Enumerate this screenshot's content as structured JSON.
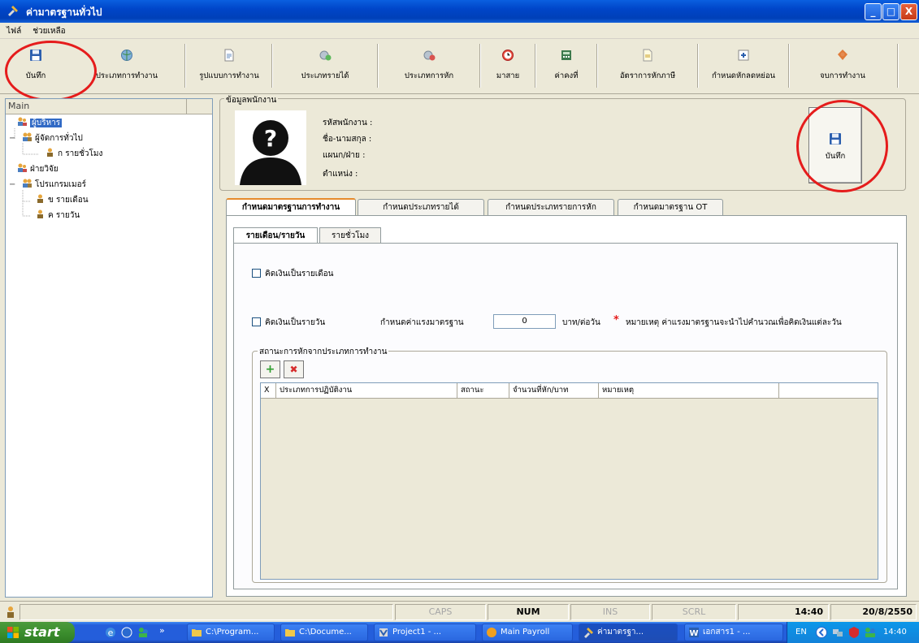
{
  "window": {
    "title": "ค่ามาตรฐานทั่วไป",
    "min": "_",
    "max": "□",
    "close": "X"
  },
  "menu": [
    "ไฟล์",
    "ช่วยเหลือ"
  ],
  "toolbar": [
    {
      "label": "บันทึก",
      "icon": "floppy-disk-icon"
    },
    {
      "label": "ประเภทการทำงาน",
      "icon": "globe-icon"
    },
    {
      "label": "รูปแบบการทำงาน",
      "icon": "document-icon"
    },
    {
      "label": "ประเภทรายได้",
      "icon": "money-add-icon"
    },
    {
      "label": "ประเภทการหัก",
      "icon": "money-remove-icon"
    },
    {
      "label": "มาสาย",
      "icon": "clock-icon"
    },
    {
      "label": "ค่าคงที่",
      "icon": "calculator-icon"
    },
    {
      "label": "อัตราการหักภาษี",
      "icon": "tax-document-icon"
    },
    {
      "label": "กำหนดหักลดหย่อน",
      "icon": "deduction-icon"
    },
    {
      "label": "จบการทำงาน",
      "icon": "exit-icon"
    }
  ],
  "tree": {
    "header": "Main",
    "items": [
      {
        "label": "ผู้บริหาร",
        "level": 0,
        "toggle": "",
        "selected": true
      },
      {
        "label": "ผู้จัดการทั่วไป",
        "level": 1,
        "toggle": "−"
      },
      {
        "label": "ก รายชั่วโมง",
        "level": 2,
        "toggle": ""
      },
      {
        "label": "ฝ่ายวิจัย",
        "level": 0,
        "toggle": ""
      },
      {
        "label": "โปรแกรมเมอร์",
        "level": 1,
        "toggle": "−"
      },
      {
        "label": "ข รายเดือน",
        "level": 2,
        "toggle": ""
      },
      {
        "label": "ค รายวัน",
        "level": 2,
        "toggle": ""
      }
    ]
  },
  "employee": {
    "caption": "ข้อมูลพนักงาน",
    "fields": [
      "รหัสพนักงาน :",
      "ชื่อ-นามสกุล :",
      "แผนก/ฝ่าย :",
      "ตำแหน่ง :"
    ],
    "photo_mark": "?",
    "save_label": "บันทึก"
  },
  "tabs": [
    "กำหนดมาตรฐานการทำงาน",
    "กำหนดประเภทรายได้",
    "กำหนดประเภทรายการหัก",
    "กำหนดมาตรฐาน OT"
  ],
  "subtabs": [
    "รายเดือน/รายวัน",
    "รายชั่วโมง"
  ],
  "form": {
    "monthly_label": "คิดเงินเป็นรายเดือน",
    "daily_label": "คิดเงินเป็นรายวัน",
    "rate_label": "กำหนดค่าแรงมาตรฐาน",
    "rate_value": "0",
    "rate_unit": "บาท/ต่อวัน",
    "required_mark": "*",
    "note": "หมายเหตุ ค่าแรงมาตรฐานจะนำไปคำนวณเพื่อคิดเงินแต่ละวัน",
    "group_caption": "สถานะการหักจากประเภทการทำงาน",
    "add_symbol": "+",
    "delete_symbol": "✖"
  },
  "grid": {
    "columns": [
      "X",
      "ประเภทการปฏิบัติงาน",
      "สถานะ",
      "จำนวนที่หัก/บาท",
      "หมายเหตุ",
      ""
    ]
  },
  "status": {
    "caps": "CAPS",
    "num": "NUM",
    "ins": "INS",
    "scrl": "SCRL",
    "time": "14:40",
    "date": "20/8/2550"
  },
  "taskbar": {
    "start": "start",
    "chevron": "»",
    "items": [
      "C:\\Program...",
      "C:\\Docume...",
      "Project1 - ...",
      "Main Payroll",
      "ค่ามาตรฐา...",
      "เอกสาร1 - ..."
    ],
    "lang": "EN",
    "clock": "14:40"
  },
  "colors": {
    "accent": "#316ac5",
    "annotation": "#e51c1c",
    "titlebar": "#0045c8",
    "start": "#3c8f2e"
  }
}
